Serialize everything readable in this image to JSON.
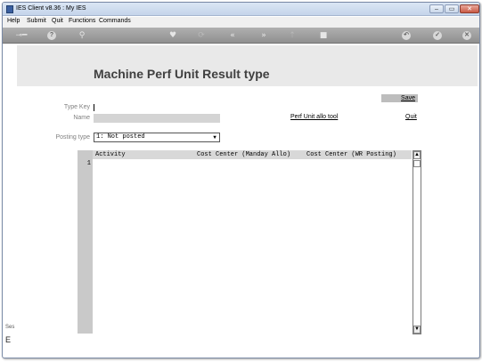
{
  "window": {
    "title": "IES Client v8.36 : My IES"
  },
  "window_controls": {
    "minimize": "–",
    "maximize": "▭",
    "close": "✕"
  },
  "menu": [
    "Help",
    "Submit",
    "Quit",
    "Functions",
    "Commands"
  ],
  "toolbar": {
    "icons": [
      "key-icon",
      "info-icon",
      "search-icon",
      "heart-icon",
      "refresh-icon",
      "rewind-icon",
      "fast-forward-icon",
      "upload-icon",
      "stop-icon",
      "back-icon",
      "check-icon",
      "close-icon"
    ]
  },
  "page": {
    "title": "Machine Perf Unit Result type"
  },
  "actions": {
    "save": "Save",
    "quit": "Quit",
    "perf_unit_tool": "Perf Unit allo tool"
  },
  "form": {
    "type_key_label": "Type Key",
    "type_key_value": "",
    "name_label": "Name",
    "name_value": "",
    "posting_type_label": "Posting type",
    "posting_type_value": "1: Not posted"
  },
  "grid": {
    "columns": [
      "Activity",
      "Cost Center (Manday Allo)",
      "Cost Center (WR Posting)"
    ],
    "row_numbers": [
      "1"
    ]
  },
  "side": {
    "frag1": "Ses",
    "frag2": "E"
  }
}
